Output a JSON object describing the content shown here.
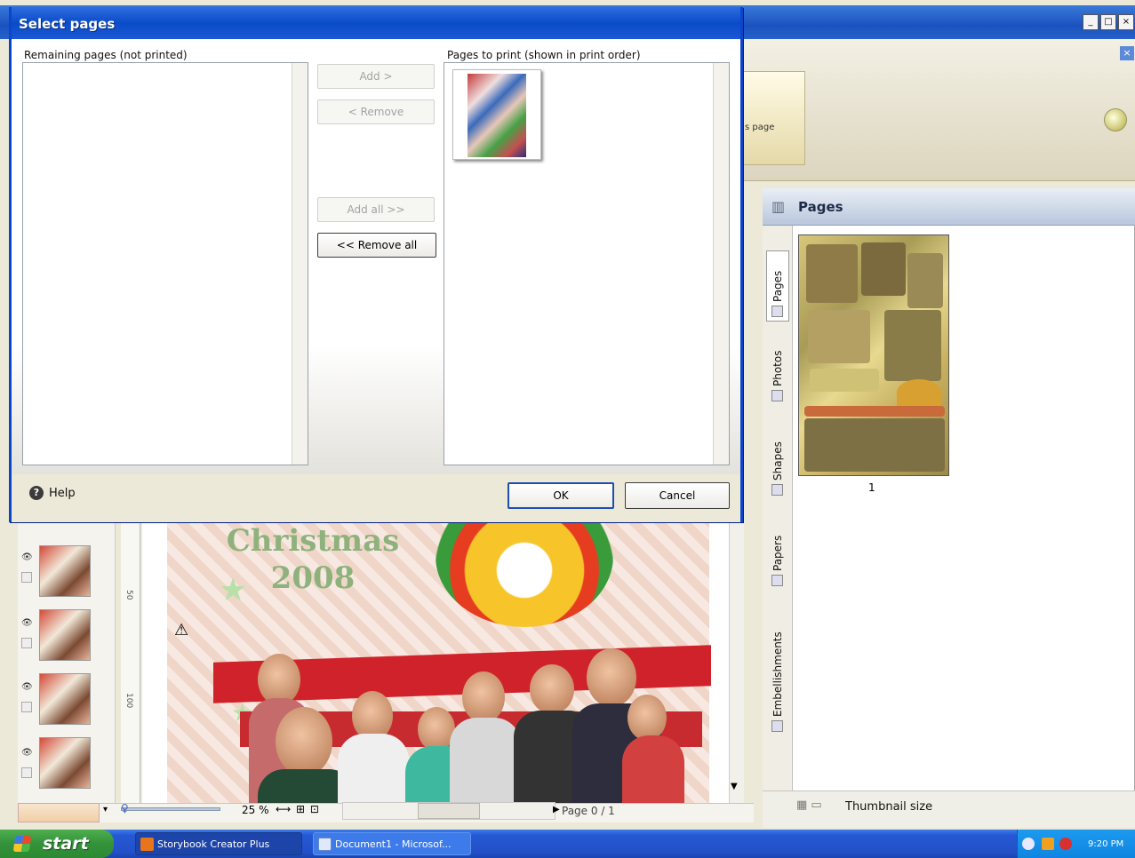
{
  "dialog": {
    "title": "Select pages",
    "remaining_label": "Remaining pages (not printed)",
    "to_print_label": "Pages to print (shown in print order)",
    "buttons": {
      "add": "Add >",
      "remove": "< Remove",
      "add_all": "Add all >>",
      "remove_all": "<< Remove all",
      "ok": "OK",
      "cancel": "Cancel"
    },
    "help_label": "Help"
  },
  "ribbon": {
    "partial_label": "s page"
  },
  "pages_panel": {
    "title": "Pages",
    "tabs": [
      "Pages",
      "Photos",
      "Shapes",
      "Papers",
      "Embellishments"
    ],
    "page_number": "1",
    "thumbnail_size_label": "Thumbnail size"
  },
  "canvas": {
    "title_line1": "Christmas",
    "title_line2": "2008"
  },
  "statusbar": {
    "zoom": "25 %",
    "page_indicator": "Page 0 / 1"
  },
  "ruler": {
    "marks": [
      "50",
      "100"
    ]
  },
  "taskbar": {
    "start_label": "start",
    "items": [
      "Storybook Creator Plus",
      "Document1 - Microsof..."
    ],
    "clock": "9:20 PM"
  },
  "window_controls": [
    "_",
    "□",
    "×"
  ],
  "colors": {
    "xp_blue": "#0a4bc8",
    "start_green": "#33923a",
    "banner_red": "#d0222a"
  }
}
